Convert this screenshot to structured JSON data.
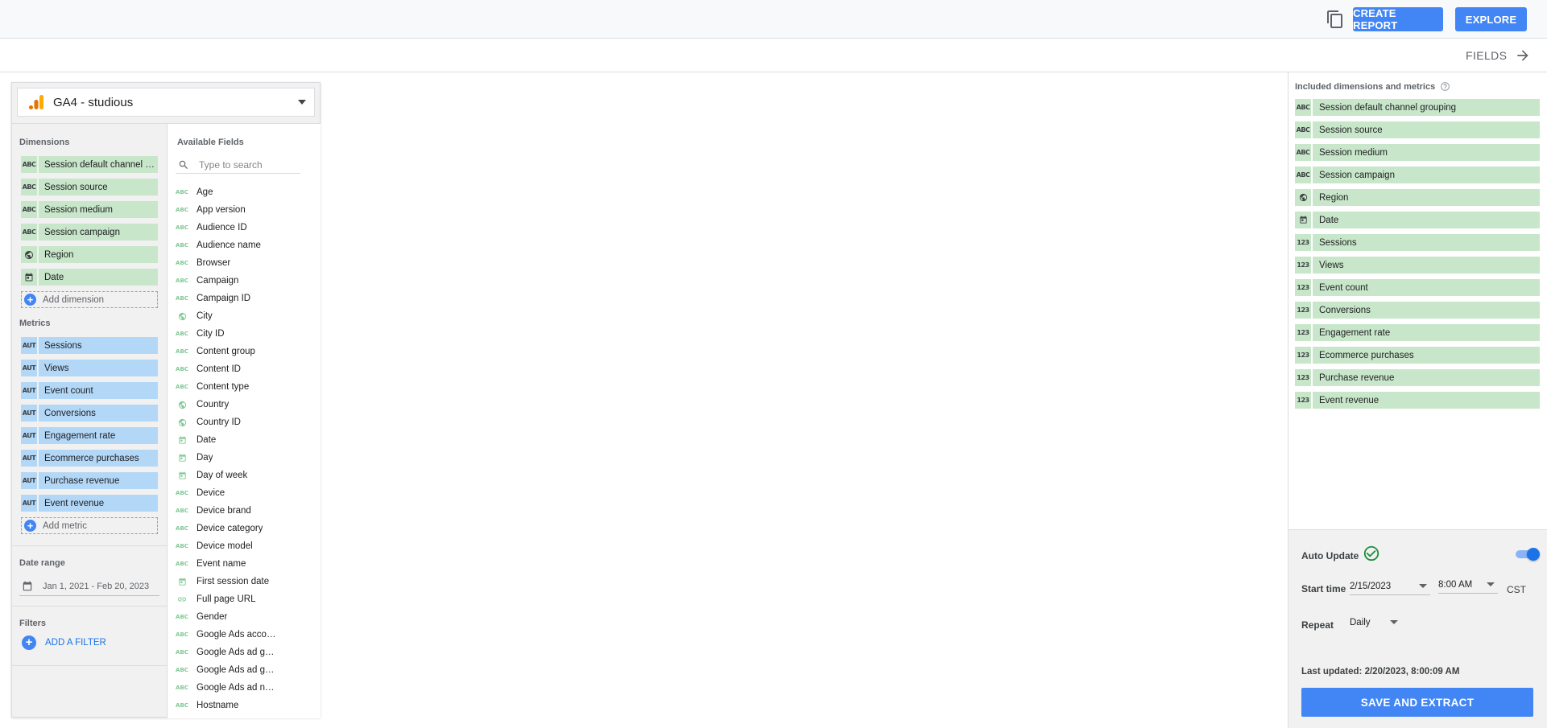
{
  "toolbar": {
    "create_report_label": "CREATE REPORT",
    "explore_label": "EXPLORE"
  },
  "fields_bar": {
    "label": "FIELDS"
  },
  "data_source": {
    "name": "GA4 - studious"
  },
  "dimensions": {
    "title": "Dimensions",
    "items": [
      {
        "type": "ABC",
        "label": "Session default channel grouping"
      },
      {
        "type": "ABC",
        "label": "Session source"
      },
      {
        "type": "ABC",
        "label": "Session medium"
      },
      {
        "type": "ABC",
        "label": "Session campaign"
      },
      {
        "type": "geo",
        "label": "Region"
      },
      {
        "type": "date",
        "label": "Date"
      }
    ],
    "add_label": "Add dimension"
  },
  "metrics": {
    "title": "Metrics",
    "items": [
      {
        "type": "AUT",
        "label": "Sessions"
      },
      {
        "type": "AUT",
        "label": "Views"
      },
      {
        "type": "AUT",
        "label": "Event count"
      },
      {
        "type": "AUT",
        "label": "Conversions"
      },
      {
        "type": "AUT",
        "label": "Engagement rate"
      },
      {
        "type": "AUT",
        "label": "Ecommerce purchases"
      },
      {
        "type": "AUT",
        "label": "Purchase revenue"
      },
      {
        "type": "AUT",
        "label": "Event revenue"
      }
    ],
    "add_label": "Add metric"
  },
  "date_range": {
    "title": "Date range",
    "value": "Jan 1, 2021 - Feb 20, 2023"
  },
  "filters": {
    "title": "Filters",
    "add_label": "ADD A FILTER"
  },
  "available_fields": {
    "title": "Available Fields",
    "search_placeholder": "Type to search",
    "items": [
      {
        "type": "ABC",
        "label": "Age"
      },
      {
        "type": "ABC",
        "label": "App version"
      },
      {
        "type": "ABC",
        "label": "Audience ID"
      },
      {
        "type": "ABC",
        "label": "Audience name"
      },
      {
        "type": "ABC",
        "label": "Browser"
      },
      {
        "type": "ABC",
        "label": "Campaign"
      },
      {
        "type": "ABC",
        "label": "Campaign ID"
      },
      {
        "type": "geo",
        "label": "City"
      },
      {
        "type": "ABC",
        "label": "City ID"
      },
      {
        "type": "ABC",
        "label": "Content group"
      },
      {
        "type": "ABC",
        "label": "Content ID"
      },
      {
        "type": "ABC",
        "label": "Content type"
      },
      {
        "type": "geo",
        "label": "Country"
      },
      {
        "type": "geo",
        "label": "Country ID"
      },
      {
        "type": "date",
        "label": "Date"
      },
      {
        "type": "date",
        "label": "Day"
      },
      {
        "type": "date",
        "label": "Day of week"
      },
      {
        "type": "ABC",
        "label": "Device"
      },
      {
        "type": "ABC",
        "label": "Device brand"
      },
      {
        "type": "ABC",
        "label": "Device category"
      },
      {
        "type": "ABC",
        "label": "Device model"
      },
      {
        "type": "ABC",
        "label": "Event name"
      },
      {
        "type": "date",
        "label": "First session date"
      },
      {
        "type": "url",
        "label": "Full page URL"
      },
      {
        "type": "ABC",
        "label": "Gender"
      },
      {
        "type": "ABC",
        "label": "Google Ads account name"
      },
      {
        "type": "ABC",
        "label": "Google Ads ad group ID"
      },
      {
        "type": "ABC",
        "label": "Google Ads ad group name"
      },
      {
        "type": "ABC",
        "label": "Google Ads ad network type"
      },
      {
        "type": "ABC",
        "label": "Hostname"
      }
    ]
  },
  "included": {
    "title": "Included dimensions and metrics",
    "items": [
      {
        "type": "ABC",
        "label": "Session default channel grouping"
      },
      {
        "type": "ABC",
        "label": "Session source"
      },
      {
        "type": "ABC",
        "label": "Session medium"
      },
      {
        "type": "ABC",
        "label": "Session campaign"
      },
      {
        "type": "geo",
        "label": "Region"
      },
      {
        "type": "date",
        "label": "Date"
      },
      {
        "type": "123",
        "label": "Sessions"
      },
      {
        "type": "123",
        "label": "Views"
      },
      {
        "type": "123",
        "label": "Event count"
      },
      {
        "type": "123",
        "label": "Conversions"
      },
      {
        "type": "123",
        "label": "Engagement rate"
      },
      {
        "type": "123",
        "label": "Ecommerce purchases"
      },
      {
        "type": "123",
        "label": "Purchase revenue"
      },
      {
        "type": "123",
        "label": "Event revenue"
      }
    ]
  },
  "extract": {
    "auto_update_label": "Auto Update",
    "auto_update_on": true,
    "start_time_label": "Start time",
    "start_date": "2/15/2023",
    "start_time": "8:00 AM",
    "timezone": "CST",
    "repeat_label": "Repeat",
    "repeat_value": "Daily",
    "last_updated": "Last updated: 2/20/2023, 8:00:09 AM",
    "save_label": "SAVE AND EXTRACT"
  },
  "colors": {
    "accent": "#4285f4",
    "dimension_chip": "#c8e6c9",
    "metric_chip": "#b3d7f7",
    "check_green": "#1e8e3e"
  }
}
